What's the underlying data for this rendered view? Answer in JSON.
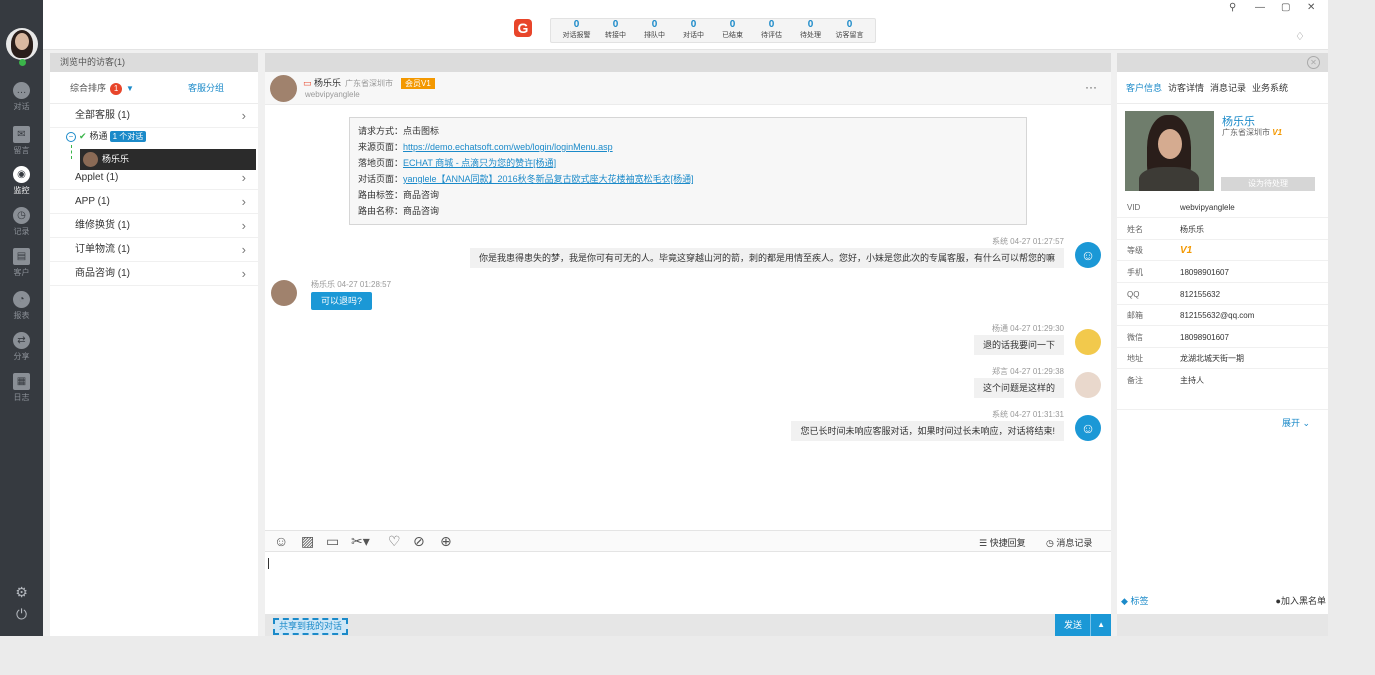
{
  "nav": {
    "items": [
      {
        "label": "对话",
        "icon": "chat-bubble-icon"
      },
      {
        "label": "留言",
        "icon": "mail-icon"
      },
      {
        "label": "监控",
        "icon": "eye-icon"
      },
      {
        "label": "记录",
        "icon": "clock-icon"
      },
      {
        "label": "客户",
        "icon": "contact-card-icon"
      },
      {
        "label": "报表",
        "icon": "pie-chart-icon"
      },
      {
        "label": "分享",
        "icon": "share-icon"
      },
      {
        "label": "日志",
        "icon": "calendar-icon"
      }
    ],
    "active": "监控"
  },
  "header": {
    "stats": [
      {
        "value": "0",
        "label": "对话报警"
      },
      {
        "value": "0",
        "label": "转接中"
      },
      {
        "value": "0",
        "label": "排队中"
      },
      {
        "value": "0",
        "label": "对话中"
      },
      {
        "value": "0",
        "label": "已结束"
      },
      {
        "value": "0",
        "label": "待评估"
      },
      {
        "value": "0",
        "label": "待处理"
      },
      {
        "value": "0",
        "label": "访客留言"
      }
    ]
  },
  "left": {
    "title": "浏览中的访客(1)",
    "tab_sort": "综合排序",
    "sort_badge": "1",
    "tab_group": "客服分组",
    "groups_top": [
      {
        "label": "全部客服 (1)"
      }
    ],
    "agent": {
      "name": "杨通",
      "count": "1 个对话"
    },
    "visitor": "杨乐乐",
    "groups": [
      {
        "label": "Applet (1)"
      },
      {
        "label": "APP (1)"
      },
      {
        "label": "维修换货 (1)"
      },
      {
        "label": "订单物流 (1)"
      },
      {
        "label": "商品咨询 (1)"
      }
    ]
  },
  "chat": {
    "visitor_name": "杨乐乐",
    "visitor_location": "广东省深圳市",
    "vip": "会员V1",
    "visitor_id": "webvipyanglele",
    "info": {
      "l1": "请求方式：点击图标",
      "l2_label": "来源页面：",
      "l2_link": "https://demo.echatsoft.com/web/login/loginMenu.asp",
      "l3_label": "落地页面：",
      "l3_link": "ECHAT 商城 - 点滴只为您的赞许[杨通]",
      "l4_label": "对话页面：",
      "l4_link": "yanglele【ANNA同款】2016秋冬新品复古欧式座大花楼袖宽松毛衣[杨通]",
      "l5": "路由标签：商品咨询",
      "l6": "路由名称：商品咨询"
    },
    "messages": [
      {
        "meta": "系统 04-27 01:27:57",
        "text": "你是我患得患失的梦，我是你可有可无的人。毕竟这穿越山河的箭，刺的都是用情至疾人。您好，小妹是您此次的专属客服，有什么可以帮您的嘛"
      },
      {
        "meta": "杨乐乐 04-27 01:28:57",
        "text": "可以退吗?"
      },
      {
        "meta": "杨通 04-27 01:29:30",
        "text": "退的话我要问一下"
      },
      {
        "meta": "郑言 04-27 01:29:38",
        "text": "这个问题是这样的"
      },
      {
        "meta": "系统 04-27 01:31:31",
        "text": "您已长时间未响应客服对话，如果时间过长未响应，对话将结束!"
      }
    ],
    "toolbar": {
      "quick_reply": "快捷回复",
      "history": "消息记录"
    },
    "share_label": "共享到我的对话",
    "send_label": "发送"
  },
  "right": {
    "tabs": [
      "客户信息",
      "访客详情",
      "消息记录",
      "业务系统"
    ],
    "name": "杨乐乐",
    "location": "广东省深圳市",
    "level_badge": "V1",
    "pending_label": "设为待处理",
    "fields": [
      {
        "k": "VID",
        "v": "webvipyanglele"
      },
      {
        "k": "姓名",
        "v": "杨乐乐"
      },
      {
        "k": "等级",
        "v": "V1"
      },
      {
        "k": "手机",
        "v": "18098901607"
      },
      {
        "k": "QQ",
        "v": "812155632"
      },
      {
        "k": "邮箱",
        "v": "812155632@qq.com"
      },
      {
        "k": "微信",
        "v": "18098901607"
      },
      {
        "k": "地址",
        "v": "龙湖北城天街一期"
      },
      {
        "k": "备注",
        "v": "主持人"
      }
    ],
    "expand_label": "展开",
    "tag_label": "标签",
    "blacklist_label": "加入黑名单"
  },
  "colors": {
    "accent": "#1b8ac9",
    "vip": "#f39800",
    "nav_bg": "#363a40"
  }
}
